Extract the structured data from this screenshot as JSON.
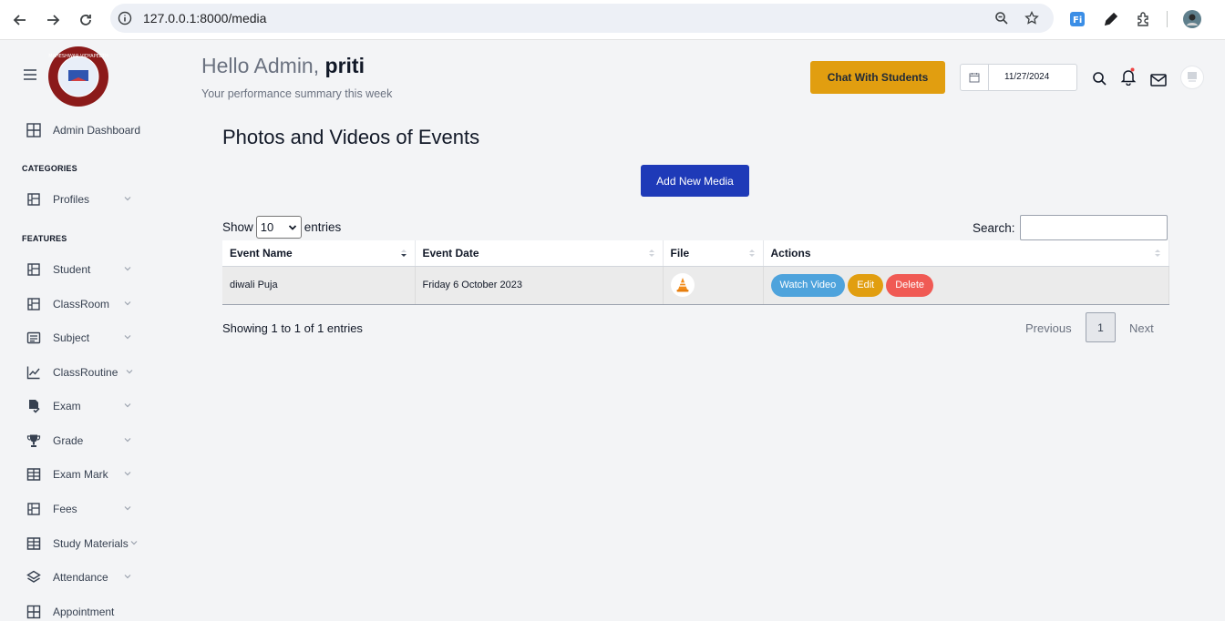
{
  "browser": {
    "url": "127.0.0.1:8000/media"
  },
  "sidebar": {
    "logo_text": "MAHESHWAR VIDYAPEETH",
    "dashboard_label": "Admin Dashboard",
    "section_categories": "CATEGORIES",
    "section_features": "FEATURES",
    "items": [
      {
        "label": "Profiles",
        "icon": "grid-icon"
      },
      {
        "label": "Student",
        "icon": "grid-icon"
      },
      {
        "label": "ClassRoom",
        "icon": "grid-icon"
      },
      {
        "label": "Subject",
        "icon": "list-icon"
      },
      {
        "label": "ClassRoutine",
        "icon": "chart-line-icon"
      },
      {
        "label": "Exam",
        "icon": "exam-icon"
      },
      {
        "label": "Grade",
        "icon": "trophy-icon"
      },
      {
        "label": "Exam Mark",
        "icon": "table-icon"
      },
      {
        "label": "Fees",
        "icon": "grid-icon"
      },
      {
        "label": "Study Materials",
        "icon": "table-icon"
      },
      {
        "label": "Attendance",
        "icon": "layers-icon"
      },
      {
        "label": "Appointment",
        "icon": "table-icon"
      }
    ]
  },
  "header": {
    "hello_prefix": "Hello Admin,",
    "user_name": "priti",
    "summary": "Your performance summary this week",
    "chat_button": "Chat With Students",
    "date_value": "11/27/2024"
  },
  "main": {
    "title": "Photos and Videos of Events",
    "add_button": "Add New Media",
    "show_label": "Show",
    "entries_value": "10",
    "entries_label": "entries",
    "search_label": "Search:",
    "columns": [
      "Event Name",
      "Event Date",
      "File",
      "Actions"
    ],
    "rows": [
      {
        "event_name": "diwali Puja",
        "event_date": "Friday 6 October 2023",
        "file_icon": "vlc-cone-icon",
        "actions": {
          "watch": "Watch Video",
          "edit": "Edit",
          "delete": "Delete"
        }
      }
    ],
    "info": "Showing 1 to 1 of 1 entries",
    "pagination": {
      "previous": "Previous",
      "current": "1",
      "next": "Next"
    }
  },
  "colors": {
    "chat_button": "#e19e10",
    "add_button": "#1e3ab8",
    "watch_button": "#4ea3dc",
    "edit_button": "#e19e10",
    "delete_button": "#f05a54"
  }
}
